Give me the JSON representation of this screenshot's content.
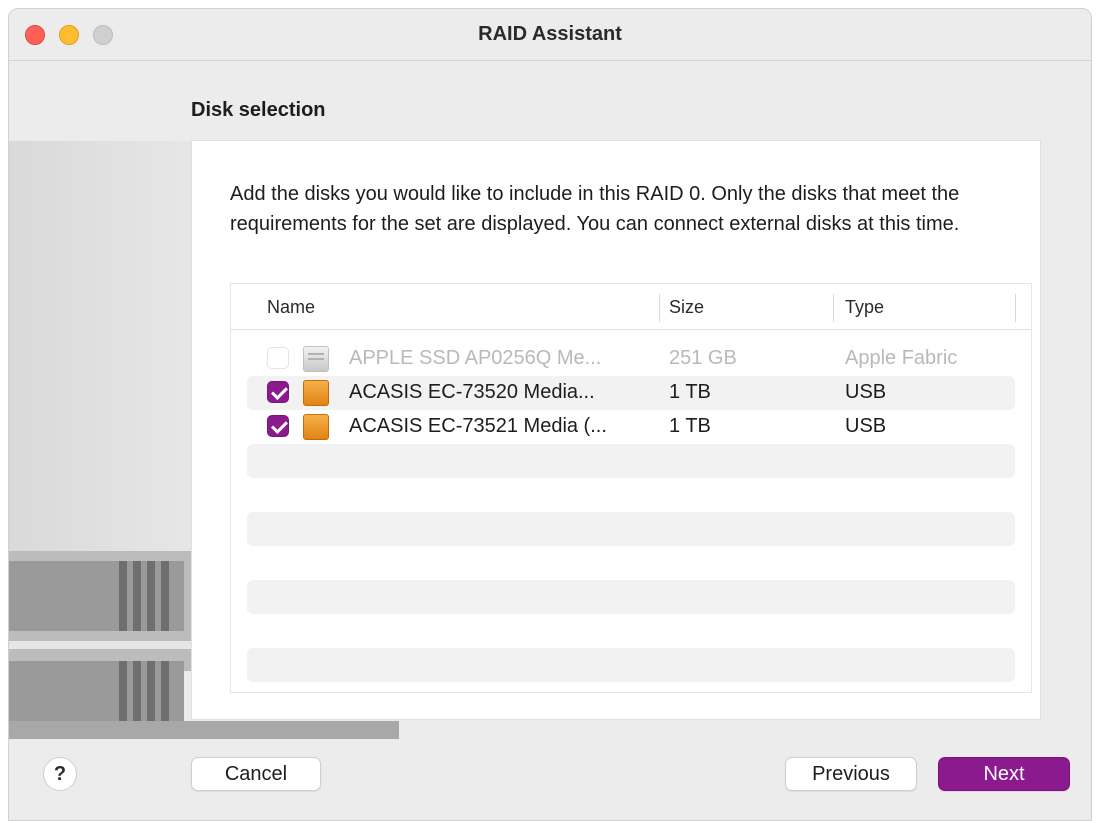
{
  "window": {
    "title": "RAID Assistant"
  },
  "section": {
    "title": "Disk selection"
  },
  "description": "Add the disks you would like to include in this RAID 0. Only the disks that meet the requirements for the set are displayed. You can connect external disks at this time.",
  "table": {
    "columns": [
      "Name",
      "Size",
      "Type"
    ],
    "rows": [
      {
        "name": "APPLE SSD AP0256Q Me...",
        "size": "251 GB",
        "type": "Apple Fabric",
        "checked": false,
        "enabled": false,
        "icon": "internal-disk-icon"
      },
      {
        "name": "ACASIS EC-73520 Media...",
        "size": "1 TB",
        "type": "USB",
        "checked": true,
        "enabled": true,
        "icon": "external-disk-icon"
      },
      {
        "name": "ACASIS EC-73521 Media (...",
        "size": "1 TB",
        "type": "USB",
        "checked": true,
        "enabled": true,
        "icon": "external-disk-icon"
      }
    ]
  },
  "buttons": {
    "help": "?",
    "cancel": "Cancel",
    "previous": "Previous",
    "next": "Next"
  },
  "colors": {
    "accent": "#8b1a8e",
    "close": "#fe5f57",
    "minimize": "#febc2e",
    "zoom_disabled": "#cfcfcf"
  }
}
